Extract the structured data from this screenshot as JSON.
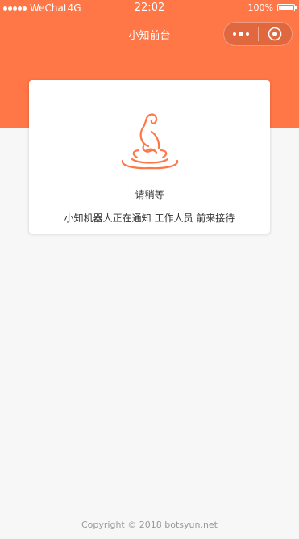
{
  "status_bar": {
    "carrier": "WeChat4G",
    "time": "22:02",
    "battery": "100%",
    "battery_level": 1.0
  },
  "nav": {
    "title": "小知前台",
    "more_icon": "more-dots-icon",
    "close_icon": "target-close-icon"
  },
  "card": {
    "logo_icon": "meditating-figure-icon",
    "wait_text": "请稍等",
    "message": "小知机器人正在通知 工作人员 前来接待"
  },
  "footer": {
    "copyright": "Copyright © 2018 botsyun.net"
  },
  "colors": {
    "brand": "#ff7647",
    "background": "#f7f7f7"
  }
}
